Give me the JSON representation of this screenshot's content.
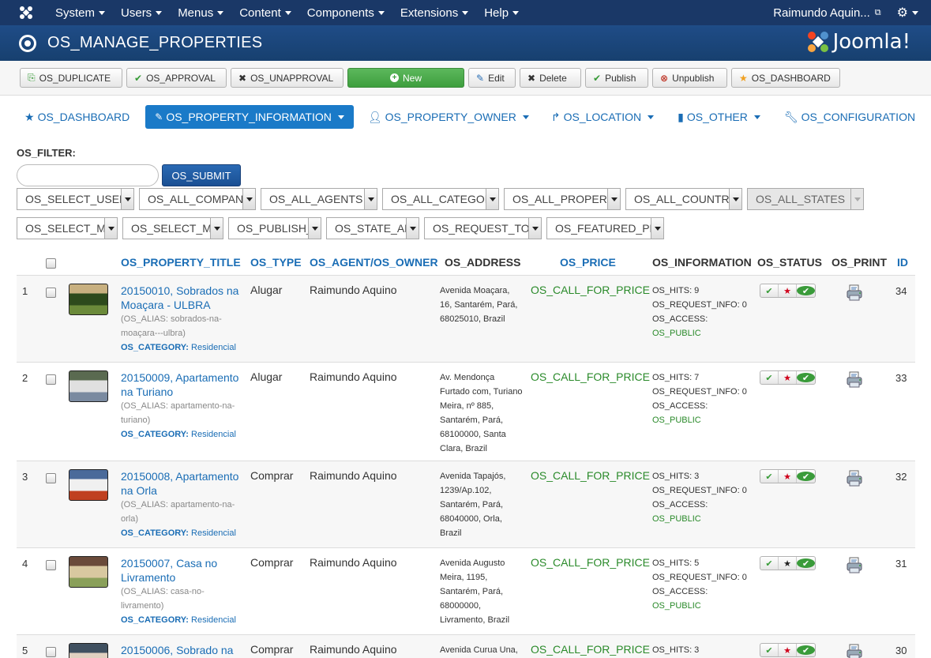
{
  "topnav": {
    "menu": [
      "System",
      "Users",
      "Menus",
      "Content",
      "Components",
      "Extensions",
      "Help"
    ],
    "user": "Raimundo Aquin..."
  },
  "titlebar": {
    "title": "OS_MANAGE_PROPERTIES",
    "brand": "Joomla!"
  },
  "toolbar": {
    "buttons": [
      {
        "label": "OS_DUPLICATE",
        "icon": "copy-icon"
      },
      {
        "label": "OS_APPROVAL",
        "icon": "check-icon"
      },
      {
        "label": "OS_UNAPPROVAL",
        "icon": "x-icon"
      },
      {
        "label": "New",
        "icon": "plus-circle-icon"
      },
      {
        "label": "Edit",
        "icon": "edit-icon"
      },
      {
        "label": "Delete",
        "icon": "x-icon"
      },
      {
        "label": "Publish",
        "icon": "check-icon"
      },
      {
        "label": "Unpublish",
        "icon": "x-circle-icon"
      },
      {
        "label": "OS_DASHBOARD",
        "icon": "star-icon"
      }
    ]
  },
  "tabs": [
    {
      "label": "OS_DASHBOARD"
    },
    {
      "label": "OS_PROPERTY_INFORMATION"
    },
    {
      "label": "OS_PROPERTY_OWNER"
    },
    {
      "label": "OS_LOCATION"
    },
    {
      "label": "OS_OTHER"
    },
    {
      "label": "OS_CONFIGURATION"
    }
  ],
  "filter": {
    "label": "OS_FILTER:",
    "search_value": "",
    "submit": "OS_SUBMIT",
    "row1": [
      "OS_SELECT_USER_TYPE",
      "OS_ALL_COMPANIES",
      "OS_ALL_AGENTS",
      "OS_ALL_CATEGORIES",
      "OS_ALL_PROPERTY_TYPES",
      "OS_ALL_COUNTRIES",
      "OS_ALL_STATES"
    ],
    "row2": [
      "OS_SELECT_MIN_PRICE",
      "OS_SELECT_MAX_PRICE",
      "OS_PUBLISH_STATUS",
      "OS_STATE_APPROVAL",
      "OS_REQUEST_TO_APPROVAL",
      "OS_FEATURED_PROPERTIES"
    ]
  },
  "table": {
    "headers": {
      "title": "OS_PROPERTY_TITLE",
      "type": "OS_TYPE",
      "agent": "OS_AGENT/OS_OWNER",
      "address": "OS_ADDRESS",
      "price": "OS_PRICE",
      "info": "OS_INFORMATION",
      "status": "OS_STATUS",
      "print": "OS_PRINT",
      "id": "ID"
    },
    "alias_prefix": "(OS_ALIAS:",
    "category_label": "OS_CATEGORY:",
    "rows": [
      {
        "num": "1",
        "title": "20150010, Sobrados na Moaçara - ULBRA",
        "alias": "(OS_ALIAS: sobrados-na-moaçara---ulbra)",
        "category": "Residencial",
        "type": "Alugar",
        "agent": "Raimundo Aquino",
        "address": "Avenida Moaçara, 16, Santarém, Pará, 68025010, Brazil",
        "price": "OS_CALL_FOR_PRICE",
        "hits": "OS_HITS: 9",
        "request": "OS_REQUEST_INFO: 0",
        "access": "OS_ACCESS:",
        "access_value": "OS_PUBLIC",
        "featured": true,
        "id": "34"
      },
      {
        "num": "2",
        "title": "20150009, Apartamento na Turiano",
        "alias": "(OS_ALIAS: apartamento-na-turiano)",
        "category": "Residencial",
        "type": "Alugar",
        "agent": "Raimundo Aquino",
        "address": "Av. Mendonça Furtado com, Turiano Meira, nº 885, Santarém, Pará, 68100000, Santa Clara, Brazil",
        "price": "OS_CALL_FOR_PRICE",
        "hits": "OS_HITS: 7",
        "request": "OS_REQUEST_INFO: 0",
        "access": "OS_ACCESS:",
        "access_value": "OS_PUBLIC",
        "featured": true,
        "id": "33"
      },
      {
        "num": "3",
        "title": "20150008, Apartamento na Orla",
        "alias": "(OS_ALIAS: apartamento-na-orla)",
        "category": "Residencial",
        "type": "Comprar",
        "agent": "Raimundo Aquino",
        "address": "Avenida Tapajós, 1239/Ap.102, Santarém, Pará, 68040000, Orla, Brazil",
        "price": "OS_CALL_FOR_PRICE",
        "hits": "OS_HITS: 3",
        "request": "OS_REQUEST_INFO: 0",
        "access": "OS_ACCESS:",
        "access_value": "OS_PUBLIC",
        "featured": true,
        "id": "32"
      },
      {
        "num": "4",
        "title": "20150007, Casa no Livramento",
        "alias": "(OS_ALIAS: casa-no-livramento)",
        "category": "Residencial",
        "type": "Comprar",
        "agent": "Raimundo Aquino",
        "address": "Avenida Augusto Meira, 1195, Santarém, Pará, 68000000, Livramento, Brazil",
        "price": "OS_CALL_FOR_PRICE",
        "hits": "OS_HITS: 5",
        "request": "OS_REQUEST_INFO: 0",
        "access": "OS_ACCESS:",
        "access_value": "OS_PUBLIC",
        "featured": false,
        "id": "31"
      },
      {
        "num": "5",
        "title": "20150006, Sobrado na",
        "alias": "",
        "category": "",
        "type": "Comprar",
        "agent": "Raimundo Aquino",
        "address": "Avenida Curua Una,",
        "price": "OS_CALL_FOR_PRICE",
        "hits": "OS_HITS: 3",
        "request": "",
        "access": "",
        "access_value": "",
        "featured": true,
        "id": "30"
      }
    ]
  },
  "colors": {
    "nav": "#1a3867",
    "titlebar": "#1f4c87",
    "link": "#1a6db5",
    "price": "#2a8a2a",
    "new_button": "#4cae4c"
  }
}
